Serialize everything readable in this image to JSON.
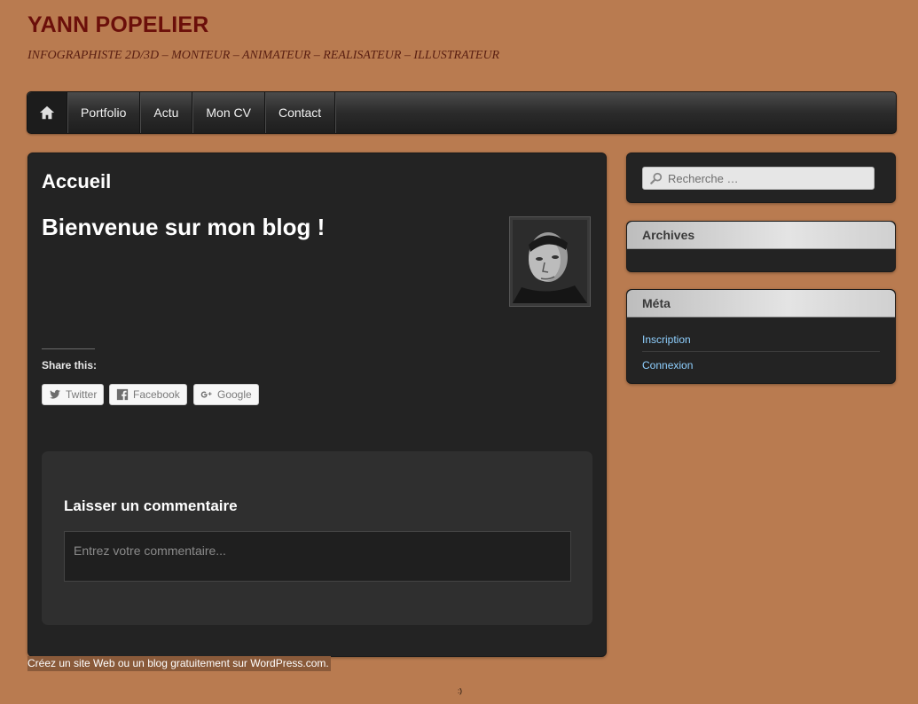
{
  "header": {
    "title": "YANN POPELIER",
    "description": "INFOGRAPHISTE 2D/3D – MONTEUR – ANIMATEUR – REALISATEUR – ILLUSTRATEUR"
  },
  "menu": {
    "home_icon": "home-icon",
    "items": [
      {
        "label": "Portfolio"
      },
      {
        "label": "Actu"
      },
      {
        "label": "Mon CV"
      },
      {
        "label": "Contact"
      }
    ]
  },
  "main": {
    "page_title": "Accueil",
    "post_title": "Bienvenue sur mon blog !",
    "share": {
      "label": "Share this:",
      "buttons": [
        {
          "label": "Twitter",
          "icon": "twitter-icon"
        },
        {
          "label": "Facebook",
          "icon": "facebook-icon"
        },
        {
          "label": "Google",
          "icon": "google-plus-icon"
        }
      ]
    },
    "comment": {
      "title": "Laisser un commentaire",
      "placeholder": "Entrez votre commentaire..."
    }
  },
  "sidebar": {
    "search_placeholder": "Recherche …",
    "archives_title": "Archives",
    "meta_title": "Méta",
    "meta_links": [
      {
        "label": "Inscription"
      },
      {
        "label": "Connexion"
      }
    ]
  },
  "footer": {
    "credit": "Créez un site Web ou un blog gratuitement sur WordPress.com.",
    "smiley": ":)"
  },
  "colors": {
    "background": "#b97b50",
    "title": "#6b0f0a",
    "panel": "#232323",
    "link": "#8fd0ff"
  }
}
